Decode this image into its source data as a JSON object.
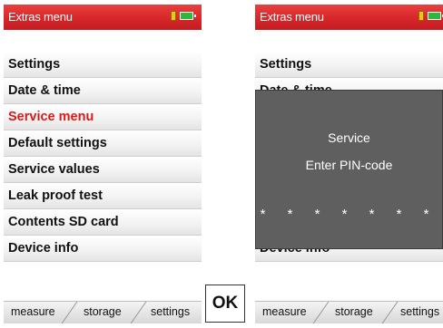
{
  "left_screen": {
    "title": "Extras menu",
    "menu_items": [
      {
        "label": "Settings"
      },
      {
        "label": "Date & time"
      },
      {
        "label": "Service menu"
      },
      {
        "label": "Default settings"
      },
      {
        "label": "Service values"
      },
      {
        "label": "Leak proof test"
      },
      {
        "label": "Contents SD card"
      },
      {
        "label": "Device info"
      }
    ],
    "selected_index": 2,
    "tabs": [
      "measure",
      "storage",
      "settings"
    ]
  },
  "ok_button": {
    "label": "OK"
  },
  "right_screen": {
    "title": "Extras menu",
    "visible_items": [
      {
        "label": "Settings"
      },
      {
        "label": "Date & time"
      },
      {
        "label": "Device info"
      }
    ],
    "dialog": {
      "title": "Service",
      "prompt": "Enter PIN-code",
      "pin_mask": "* * * * * * *"
    },
    "tabs": [
      "measure",
      "storage",
      "settings"
    ]
  },
  "colors": {
    "titlebar": "#d8262a",
    "selected_text": "#e01818",
    "dialog_bg": "#5f5f5f",
    "battery": "#2db83d",
    "sd_card": "#f0c419"
  },
  "icons": [
    "sd-card-icon",
    "battery-icon"
  ]
}
